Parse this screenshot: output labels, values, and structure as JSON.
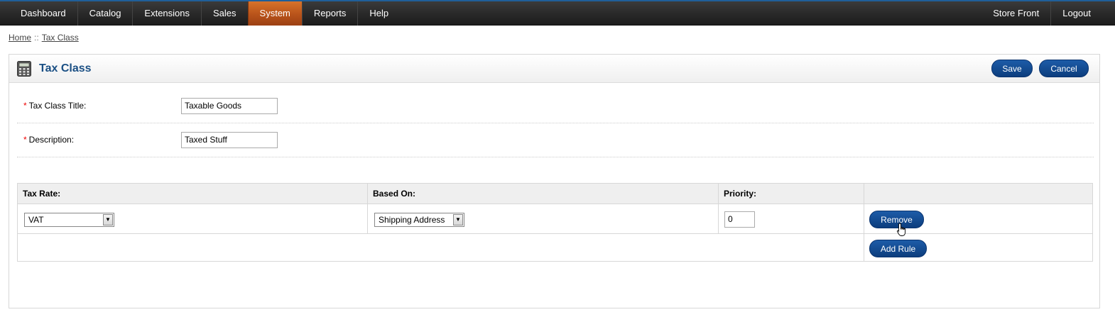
{
  "nav": {
    "items": [
      {
        "label": "Dashboard",
        "active": false
      },
      {
        "label": "Catalog",
        "active": false
      },
      {
        "label": "Extensions",
        "active": false
      },
      {
        "label": "Sales",
        "active": false
      },
      {
        "label": "System",
        "active": true
      },
      {
        "label": "Reports",
        "active": false
      },
      {
        "label": "Help",
        "active": false
      }
    ],
    "right_items": [
      {
        "label": "Store Front"
      },
      {
        "label": "Logout"
      }
    ]
  },
  "breadcrumb": {
    "home": "Home",
    "separator": "::",
    "current": "Tax Class"
  },
  "heading": {
    "title": "Tax Class",
    "icon": "calculator-icon",
    "save_label": "Save",
    "cancel_label": "Cancel"
  },
  "form": {
    "title_label": "Tax Class Title:",
    "title_value": "Taxable Goods",
    "description_label": "Description:",
    "description_value": "Taxed Stuff",
    "required_mark": "*"
  },
  "rules": {
    "headers": [
      "Tax Rate:",
      "Based On:",
      "Priority:",
      ""
    ],
    "rows": [
      {
        "tax_rate": "VAT",
        "based_on": "Shipping Address",
        "priority": "0",
        "remove_label": "Remove"
      }
    ],
    "add_rule_label": "Add Rule"
  },
  "colors": {
    "accent": "#0c3d7d",
    "active_nav": "#c0581c",
    "title": "#1a4f84"
  }
}
